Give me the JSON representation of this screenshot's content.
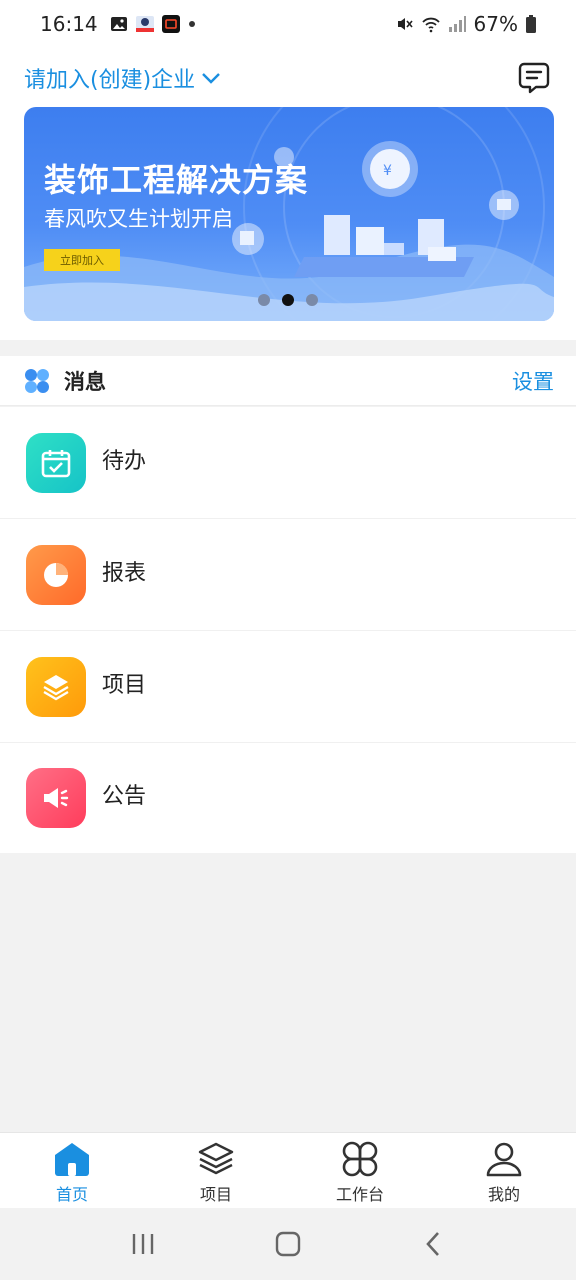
{
  "status_bar": {
    "time": "16:14",
    "battery": "67%"
  },
  "header": {
    "company_select": "请加入(创建)企业"
  },
  "banner": {
    "title": "装饰工程解决方案",
    "subtitle": "春风吹又生计划开启",
    "button": "立即加入",
    "page_index": 2,
    "page_count": 3
  },
  "messages": {
    "title": "消息",
    "settings": "设置",
    "items": [
      {
        "label": "待办",
        "icon": "calendar-check-icon",
        "color": "#1ed3c2"
      },
      {
        "label": "报表",
        "icon": "pie-chart-icon",
        "color": "#ff7a35"
      },
      {
        "label": "项目",
        "icon": "layers-icon",
        "color": "#ffae10"
      },
      {
        "label": "公告",
        "icon": "megaphone-icon",
        "color": "#ff4f6a"
      }
    ]
  },
  "bottom_nav": {
    "items": [
      {
        "label": "首页",
        "icon": "home-icon",
        "active": true
      },
      {
        "label": "项目",
        "icon": "layers-icon",
        "active": false
      },
      {
        "label": "工作台",
        "icon": "grid-icon",
        "active": false
      },
      {
        "label": "我的",
        "icon": "user-icon",
        "active": false
      }
    ]
  },
  "colors": {
    "accent": "#1a8fe0",
    "banner_blue": "#3d7eef",
    "banner_button": "#f6d21b"
  }
}
